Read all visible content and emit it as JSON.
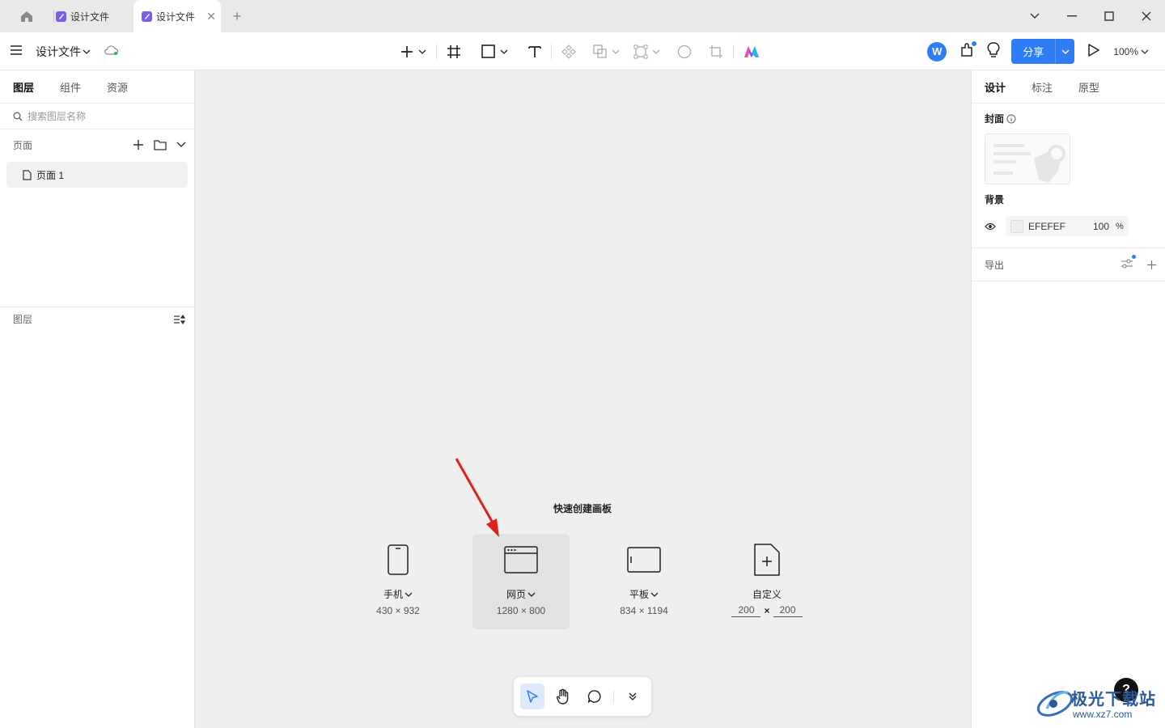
{
  "tabs": [
    {
      "label": "设计文件",
      "active": false
    },
    {
      "label": "设计文件",
      "active": true
    }
  ],
  "toolbar": {
    "doc_title": "设计文件",
    "share_label": "分享",
    "avatar_letter": "W",
    "zoom": "100%"
  },
  "left_panel": {
    "tabs": [
      "图层",
      "组件",
      "资源"
    ],
    "search_placeholder": "搜索图层名称",
    "pages_header": "页面",
    "page_item": "页面 1",
    "layers_header": "图层"
  },
  "right_panel": {
    "tabs": [
      "设计",
      "标注",
      "原型"
    ],
    "cover_title": "封面",
    "background_title": "背景",
    "background_hex": "EFEFEF",
    "background_opacity": "100",
    "opacity_unit": "%",
    "export_title": "导出"
  },
  "canvas": {
    "quick_title": "快速创建画板",
    "presets": [
      {
        "name": "手机",
        "size": "430 × 932"
      },
      {
        "name": "网页",
        "size": "1280 × 800"
      },
      {
        "name": "平板",
        "size": "834 × 1194"
      },
      {
        "name": "自定义",
        "width": "200",
        "height": "200",
        "times": "×"
      }
    ],
    "selected_preset": "网页"
  },
  "help_label": "?",
  "watermark": {
    "text": "极光下载站",
    "url": "www.xz7.com"
  },
  "colors": {
    "accent": "#2e7cf6",
    "canvas_bg": "#efefef",
    "arrow": "#e0201b",
    "brand_badge": "#7b5cf0"
  }
}
